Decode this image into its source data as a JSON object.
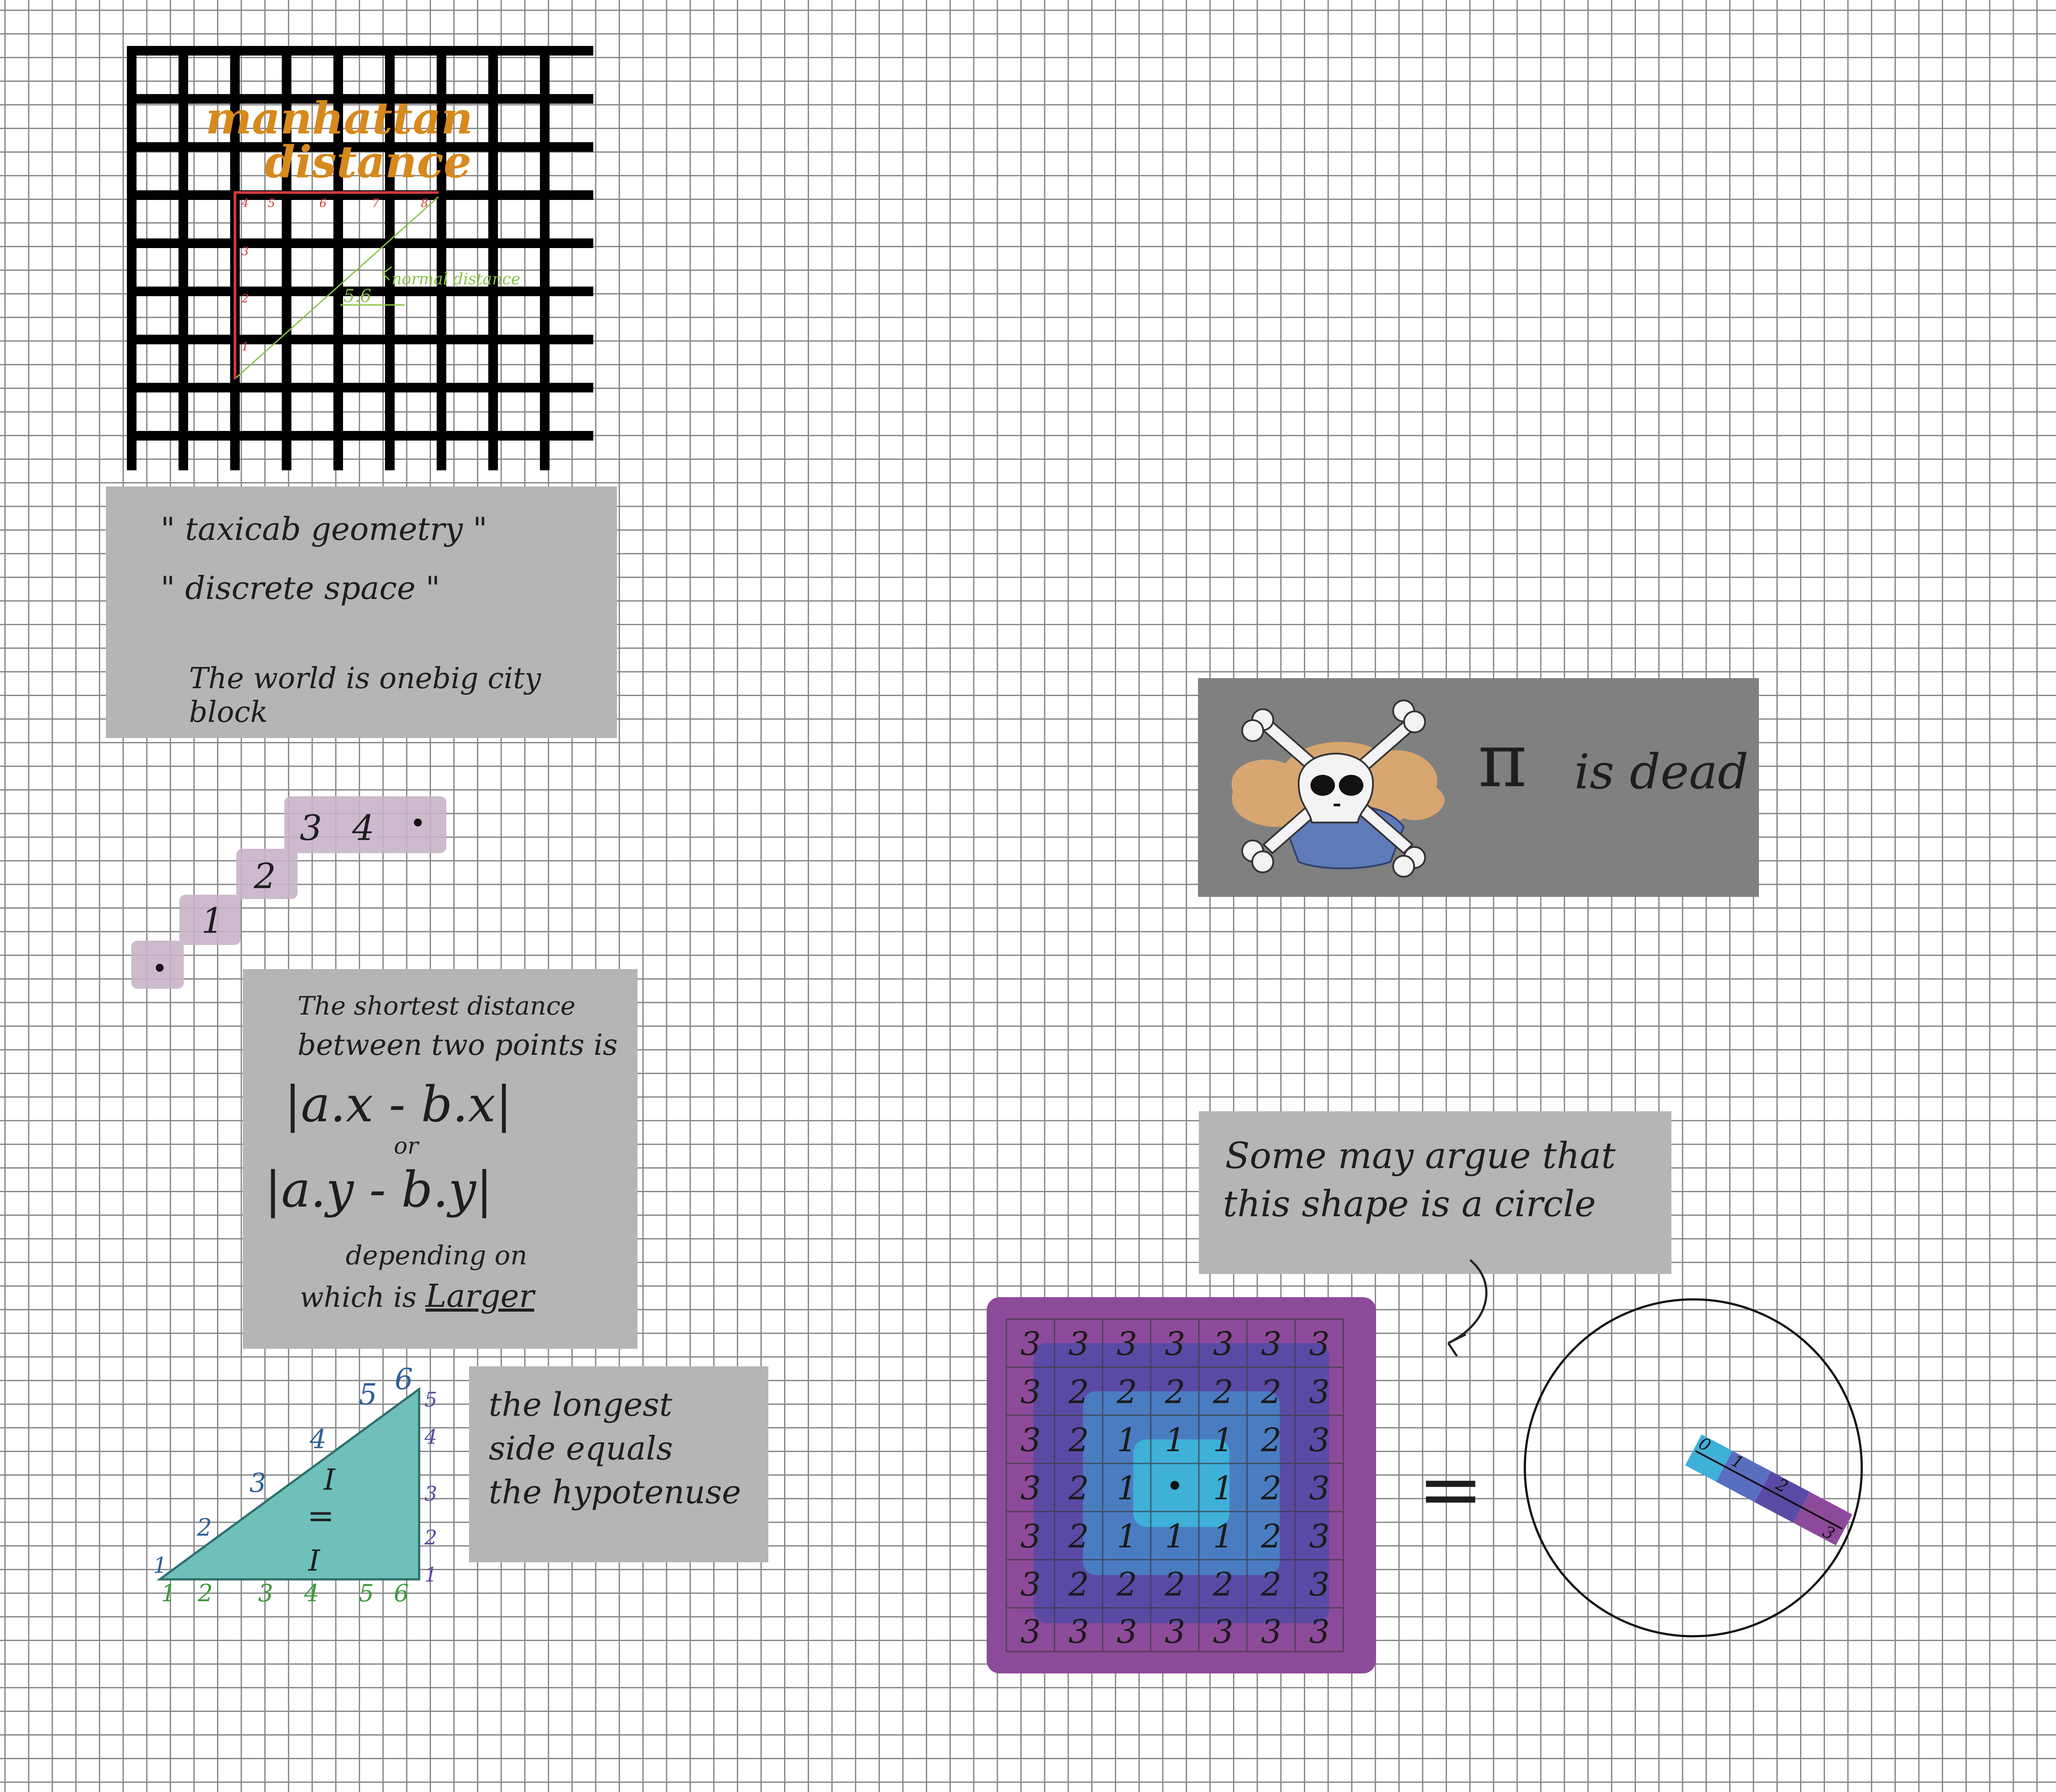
{
  "colors": {
    "card_gray": "#b5b5b5",
    "card_dark_gray": "#808080",
    "title_orange": "#d6891c",
    "manhattan_red": "#d23a3a",
    "euclid_green": "#8bc34a",
    "triangle_teal": "#6fbfbb",
    "ring_purple": "#8e4a9a",
    "ring_indigo": "#5a4aa6",
    "ring_blue": "#4a7cc2",
    "ring_cyan": "#3fb0d8",
    "step_mauve": "#c8b3c8"
  },
  "city_grid": {
    "title_line1": "manhattan",
    "title_line2": "distance",
    "top_ticks": [
      "4",
      "5",
      "6",
      "7",
      "8"
    ],
    "side_ticks": [
      "3",
      "2",
      "1"
    ],
    "diagonal_value": "5.6",
    "diagonal_label": "normal distance"
  },
  "taxicab_card": {
    "line1": "\" taxicab geometry \"",
    "line2": "\" discrete space \"",
    "line3": "The world is onebig city block"
  },
  "steps": {
    "labels": [
      "1",
      "2",
      "3",
      "4"
    ]
  },
  "distance_card": {
    "line1": "The shortest distance",
    "line2": "between two points is",
    "formula1": "|a.x - b.x|",
    "or": "or",
    "formula2": "|a.y - b.y|",
    "line3": "depending on",
    "line4_prefix": "which is",
    "line4_emph": "Larger"
  },
  "triangle": {
    "bottom_ticks": [
      "1",
      "2",
      "3",
      "4",
      "5",
      "6"
    ],
    "right_ticks": [
      "1",
      "2",
      "3",
      "4",
      "5"
    ],
    "hyp_ticks": [
      "1",
      "2",
      "3",
      "4",
      "5",
      "6"
    ],
    "equals_left": "I",
    "equals_sign": "=",
    "equals_right": "I"
  },
  "hypotenuse_card": {
    "line1": "the longest",
    "line2": "side equals",
    "line3": "the hypotenuse"
  },
  "pi_card": {
    "symbol": "π",
    "text": "is dead"
  },
  "circle_card": {
    "line1": "Some may argue that",
    "line2": "this shape is a circle"
  },
  "distance_rings": {
    "rows": [
      [
        "3",
        "3",
        "3",
        "3",
        "3",
        "3",
        "3"
      ],
      [
        "3",
        "2",
        "2",
        "2",
        "2",
        "2",
        "3"
      ],
      [
        "3",
        "2",
        "1",
        "1",
        "1",
        "2",
        "3"
      ],
      [
        "3",
        "2",
        "1",
        "",
        "1",
        "2",
        "3"
      ],
      [
        "3",
        "2",
        "1",
        "1",
        "1",
        "2",
        "3"
      ],
      [
        "3",
        "2",
        "2",
        "2",
        "2",
        "2",
        "3"
      ],
      [
        "3",
        "3",
        "3",
        "3",
        "3",
        "3",
        "3"
      ]
    ]
  },
  "equals": "=",
  "radius_bar": {
    "labels": [
      "0",
      "1",
      "2",
      "3"
    ]
  }
}
